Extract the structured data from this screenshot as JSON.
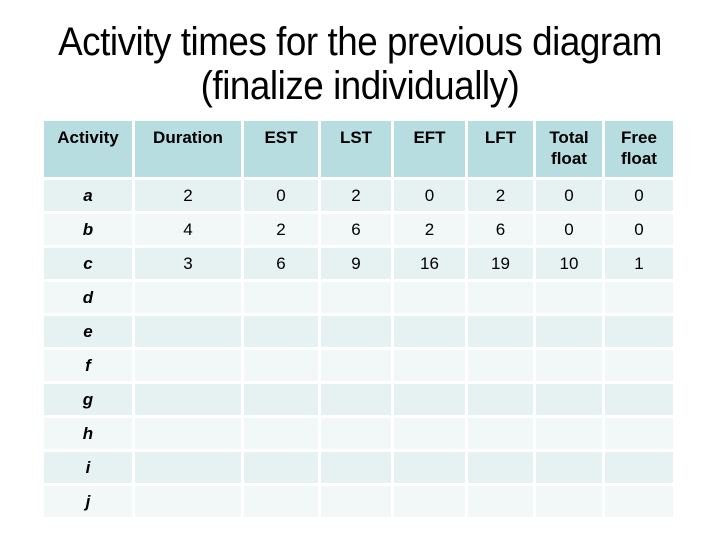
{
  "title_line1": "Activity times for the previous diagram",
  "title_line2": "(finalize individually)",
  "colors": {
    "header_bg": "#b8dde1",
    "row_odd_bg": "#e6f1f2",
    "row_even_bg": "#f2f7f8"
  },
  "table": {
    "headers": [
      "Activity",
      "Duration",
      "EST",
      "LST",
      "EFT",
      "LFT",
      "Total float",
      "Free float"
    ],
    "rows": [
      [
        "a",
        "2",
        "0",
        "2",
        "0",
        "2",
        "0",
        "0"
      ],
      [
        "b",
        "4",
        "2",
        "6",
        "2",
        "6",
        "0",
        "0"
      ],
      [
        "c",
        "3",
        "6",
        "9",
        "16",
        "19",
        "10",
        "1"
      ],
      [
        "d",
        "",
        "",
        "",
        "",
        "",
        "",
        ""
      ],
      [
        "e",
        "",
        "",
        "",
        "",
        "",
        "",
        ""
      ],
      [
        "f",
        "",
        "",
        "",
        "",
        "",
        "",
        ""
      ],
      [
        "g",
        "",
        "",
        "",
        "",
        "",
        "",
        ""
      ],
      [
        "h",
        "",
        "",
        "",
        "",
        "",
        "",
        ""
      ],
      [
        "i",
        "",
        "",
        "",
        "",
        "",
        "",
        ""
      ],
      [
        "j",
        "",
        "",
        "",
        "",
        "",
        "",
        ""
      ]
    ]
  }
}
